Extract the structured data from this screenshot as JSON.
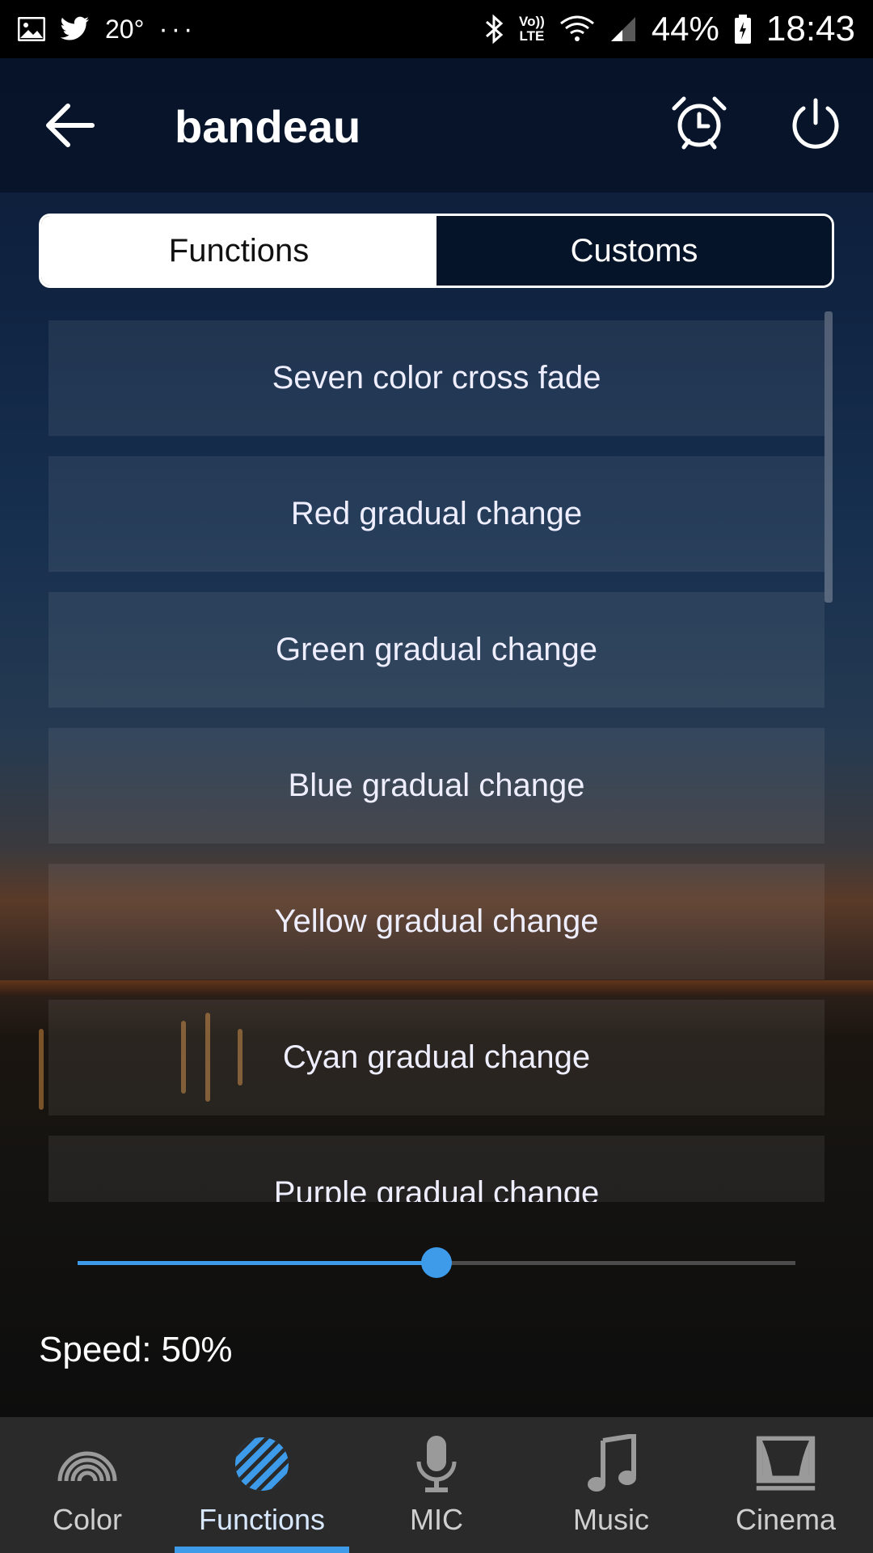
{
  "status_bar": {
    "temperature": "20°",
    "dots": "···",
    "network_label_top": "Vo))",
    "network_label_bottom": "LTE",
    "battery": "44%",
    "time": "18:43"
  },
  "header": {
    "title": "bandeau"
  },
  "tabs": [
    {
      "label": "Functions",
      "active": true
    },
    {
      "label": "Customs",
      "active": false
    }
  ],
  "functions": [
    "Seven color cross fade",
    "Red gradual change",
    "Green gradual change",
    "Blue gradual change",
    "Yellow gradual change",
    "Cyan gradual change",
    "Purple gradual change"
  ],
  "speed": {
    "label": "Speed:",
    "value": "50%",
    "fraction": 0.5
  },
  "bottom_nav": [
    {
      "label": "Color",
      "icon": "rainbow-icon"
    },
    {
      "label": "Functions",
      "icon": "striped-circle-icon",
      "active": true
    },
    {
      "label": "MIC",
      "icon": "microphone-icon"
    },
    {
      "label": "Music",
      "icon": "music-note-icon"
    },
    {
      "label": "Cinema",
      "icon": "cinema-icon"
    }
  ],
  "colors": {
    "accent": "#3d9be9",
    "header_bg": "#051226"
  }
}
